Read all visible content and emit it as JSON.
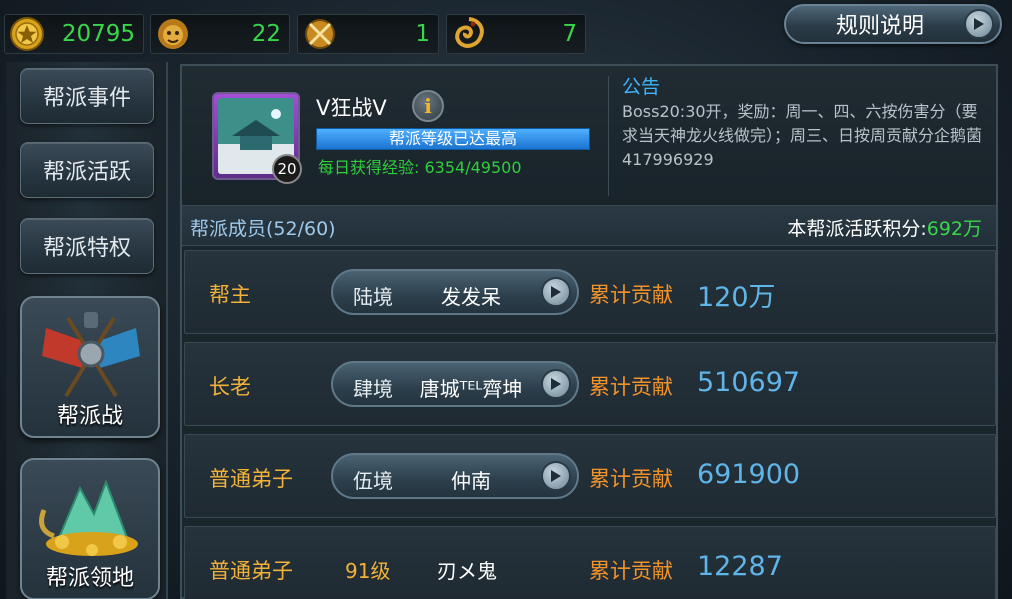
{
  "resources": [
    {
      "icon": "gold-coin-icon",
      "value": "20795"
    },
    {
      "icon": "lion-head-icon",
      "value": "22"
    },
    {
      "icon": "crossed-swords-medal-icon",
      "value": "1"
    },
    {
      "icon": "dragon-token-icon",
      "value": "7"
    }
  ],
  "rules_button": {
    "label": "规则说明"
  },
  "sidebar": {
    "items": [
      {
        "label": "帮派事件"
      },
      {
        "label": "帮派活跃"
      },
      {
        "label": "帮派特权"
      }
    ],
    "big_items": [
      {
        "label": "帮派战"
      },
      {
        "label": "帮派领地"
      }
    ]
  },
  "guild": {
    "name": "V狂战V",
    "avatar_level": "20",
    "level_bar_text": "帮派等级已达最高",
    "level_progress": 1.0,
    "exp_label": "每日获得经验:",
    "exp_value": "6354/49500"
  },
  "notice": {
    "title": "公告",
    "body": "Boss20:30开，奖励：周一、四、六按伤害分（要求当天神龙火线做完）；周三、日按周贡献分企鹅菌417996929"
  },
  "members_header": {
    "label": "帮派成员(52/60)",
    "activity_label": "本帮派活跃积分:",
    "activity_value": "692万"
  },
  "members": [
    {
      "role": "帮主",
      "realm": "陆境",
      "name": "发发呆",
      "contrib_label": "累计贡献",
      "contrib": "120万"
    },
    {
      "role": "长老",
      "realm": "肆境",
      "name": "唐城ᵀᴱᴸ齊坤",
      "contrib_label": "累计贡献",
      "contrib": "510697"
    },
    {
      "role": "普通弟子",
      "realm": "伍境",
      "name": "仲南",
      "contrib_label": "累计贡献",
      "contrib": "691900"
    },
    {
      "role": "普通弟子",
      "level": "91级",
      "name": "刃メ鬼",
      "contrib_label": "累计贡献",
      "contrib": "12287"
    }
  ]
}
